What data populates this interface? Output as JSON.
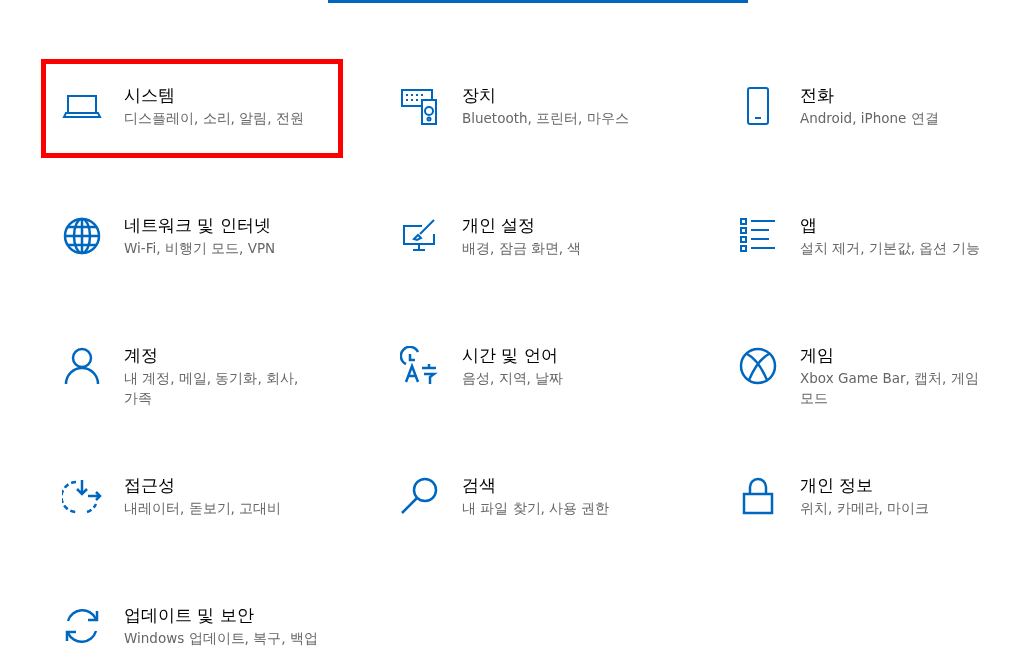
{
  "search": {
    "focused": true
  },
  "categories": [
    {
      "title": "시스템",
      "subtitle": "디스플레이, 소리, 알림, 전원",
      "highlighted": true
    },
    {
      "title": "장치",
      "subtitle": "Bluetooth, 프린터, 마우스",
      "highlighted": false
    },
    {
      "title": "전화",
      "subtitle": "Android, iPhone 연결",
      "highlighted": false
    },
    {
      "title": "네트워크 및 인터넷",
      "subtitle": "Wi-Fi, 비행기 모드, VPN",
      "highlighted": false
    },
    {
      "title": "개인 설정",
      "subtitle": "배경, 잠금 화면, 색",
      "highlighted": false
    },
    {
      "title": "앱",
      "subtitle": "설치 제거, 기본값, 옵션 기능",
      "highlighted": false
    },
    {
      "title": "계정",
      "subtitle": "내 계정, 메일, 동기화, 회사, 가족",
      "highlighted": false
    },
    {
      "title": "시간 및 언어",
      "subtitle": "음성, 지역, 날짜",
      "highlighted": false
    },
    {
      "title": "게임",
      "subtitle": "Xbox Game Bar, 캡처, 게임 모드",
      "highlighted": false
    },
    {
      "title": "접근성",
      "subtitle": "내레이터, 돋보기, 고대비",
      "highlighted": false
    },
    {
      "title": "검색",
      "subtitle": "내 파일 찾기, 사용 권한",
      "highlighted": false
    },
    {
      "title": "개인 정보",
      "subtitle": "위치, 카메라, 마이크",
      "highlighted": false
    },
    {
      "title": "업데이트 및 보안",
      "subtitle": "Windows 업데이트, 복구, 백업",
      "highlighted": false
    }
  ]
}
